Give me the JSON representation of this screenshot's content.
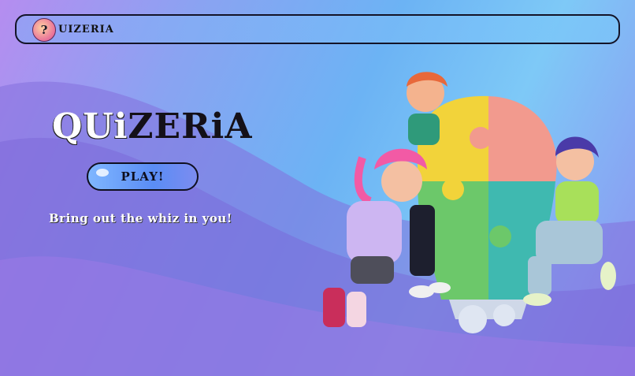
{
  "navbar": {
    "logo_glyph": "?",
    "brand": "UIZERIA"
  },
  "hero": {
    "title_part1": "QUi",
    "title_part2": "ZERiA",
    "play_label": "PLAY!",
    "tagline": "Bring out the whiz in you!"
  },
  "colors": {
    "navbar_border": "#141428",
    "play_button": "#5a8df5",
    "puzzle_yellow": "#f2d33a",
    "puzzle_pink": "#f29a8e",
    "puzzle_green": "#6cc86a",
    "puzzle_teal": "#3fb9b0"
  },
  "illustration": {
    "icon": "puzzle-lightbulb-team-illustration"
  }
}
